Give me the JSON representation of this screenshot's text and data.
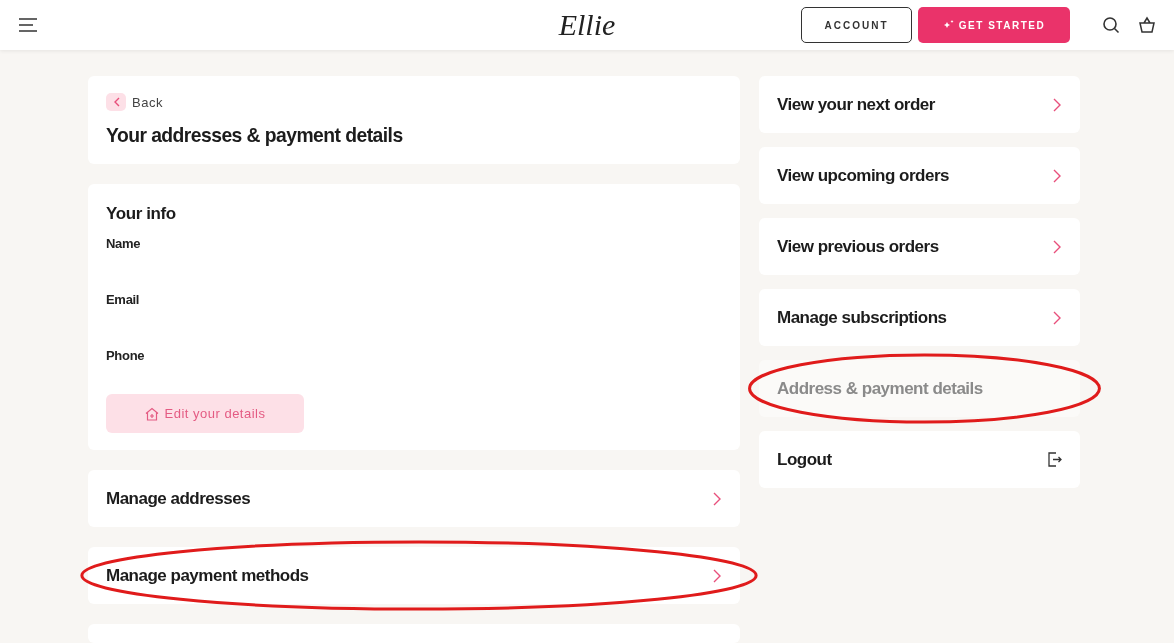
{
  "header": {
    "logo": "Ellie",
    "account_button": "ACCOUNT",
    "cta_button": "GET STARTED"
  },
  "back_card": {
    "back_link": "Back",
    "title": "Your addresses & payment details"
  },
  "info_card": {
    "title": "Your info",
    "fields": [
      {
        "label": "Name"
      },
      {
        "label": "Email"
      },
      {
        "label": "Phone"
      }
    ],
    "edit_button": "Edit your details"
  },
  "left_links": [
    {
      "label": "Manage addresses",
      "highlighted": false
    },
    {
      "label": "Manage payment methods",
      "highlighted": true
    }
  ],
  "side_menu": [
    {
      "label": "View your next order",
      "kind": "link",
      "selected": false,
      "highlighted": false
    },
    {
      "label": "View upcoming orders",
      "kind": "link",
      "selected": false,
      "highlighted": false
    },
    {
      "label": "View previous orders",
      "kind": "link",
      "selected": false,
      "highlighted": false
    },
    {
      "label": "Manage subscriptions",
      "kind": "link",
      "selected": false,
      "highlighted": false
    },
    {
      "label": "Address & payment details",
      "kind": "link",
      "selected": true,
      "highlighted": true
    },
    {
      "label": "Logout",
      "kind": "logout",
      "selected": false,
      "highlighted": false
    }
  ]
}
